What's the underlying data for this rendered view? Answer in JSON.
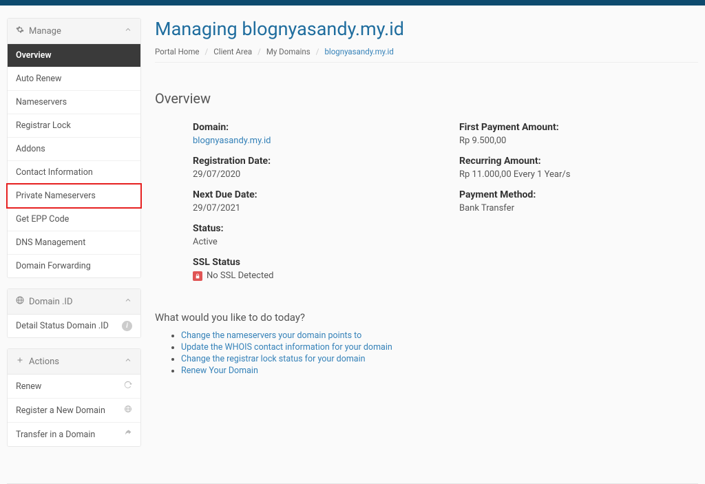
{
  "sidebar": {
    "manage": {
      "title": "Manage",
      "items": [
        {
          "label": "Overview"
        },
        {
          "label": "Auto Renew"
        },
        {
          "label": "Nameservers"
        },
        {
          "label": "Registrar Lock"
        },
        {
          "label": "Addons"
        },
        {
          "label": "Contact Information"
        },
        {
          "label": "Private Nameservers"
        },
        {
          "label": "Get EPP Code"
        },
        {
          "label": "DNS Management"
        },
        {
          "label": "Domain Forwarding"
        }
      ]
    },
    "domain_id": {
      "title": "Domain .ID",
      "items": [
        {
          "label": "Detail Status Domain .ID"
        }
      ]
    },
    "actions": {
      "title": "Actions",
      "items": [
        {
          "label": "Renew"
        },
        {
          "label": "Register a New Domain"
        },
        {
          "label": "Transfer in a Domain"
        }
      ]
    }
  },
  "page": {
    "title": "Managing blognyasandy.my.id",
    "breadcrumb": [
      {
        "label": "Portal Home"
      },
      {
        "label": "Client Area"
      },
      {
        "label": "My Domains"
      },
      {
        "label": "blognyasandy.my.id"
      }
    ]
  },
  "overview": {
    "heading": "Overview",
    "left": {
      "domain_label": "Domain:",
      "domain_value": "blognyasandy.my.id",
      "reg_date_label": "Registration Date:",
      "reg_date_value": "29/07/2020",
      "due_date_label": "Next Due Date:",
      "due_date_value": "29/07/2021",
      "status_label": "Status:",
      "status_value": "Active",
      "ssl_label": "SSL Status",
      "ssl_value": "No SSL Detected"
    },
    "right": {
      "first_payment_label": "First Payment Amount:",
      "first_payment_value": "Rp 9.500,00",
      "recurring_label": "Recurring Amount:",
      "recurring_value": "Rp 11.000,00 Every 1 Year/s",
      "payment_method_label": "Payment Method:",
      "payment_method_value": "Bank Transfer"
    }
  },
  "todo": {
    "heading": "What would you like to do today?",
    "items": [
      "Change the nameservers your domain points to",
      "Update the WHOIS contact information for your domain",
      "Change the registrar lock status for your domain",
      "Renew Your Domain"
    ]
  }
}
